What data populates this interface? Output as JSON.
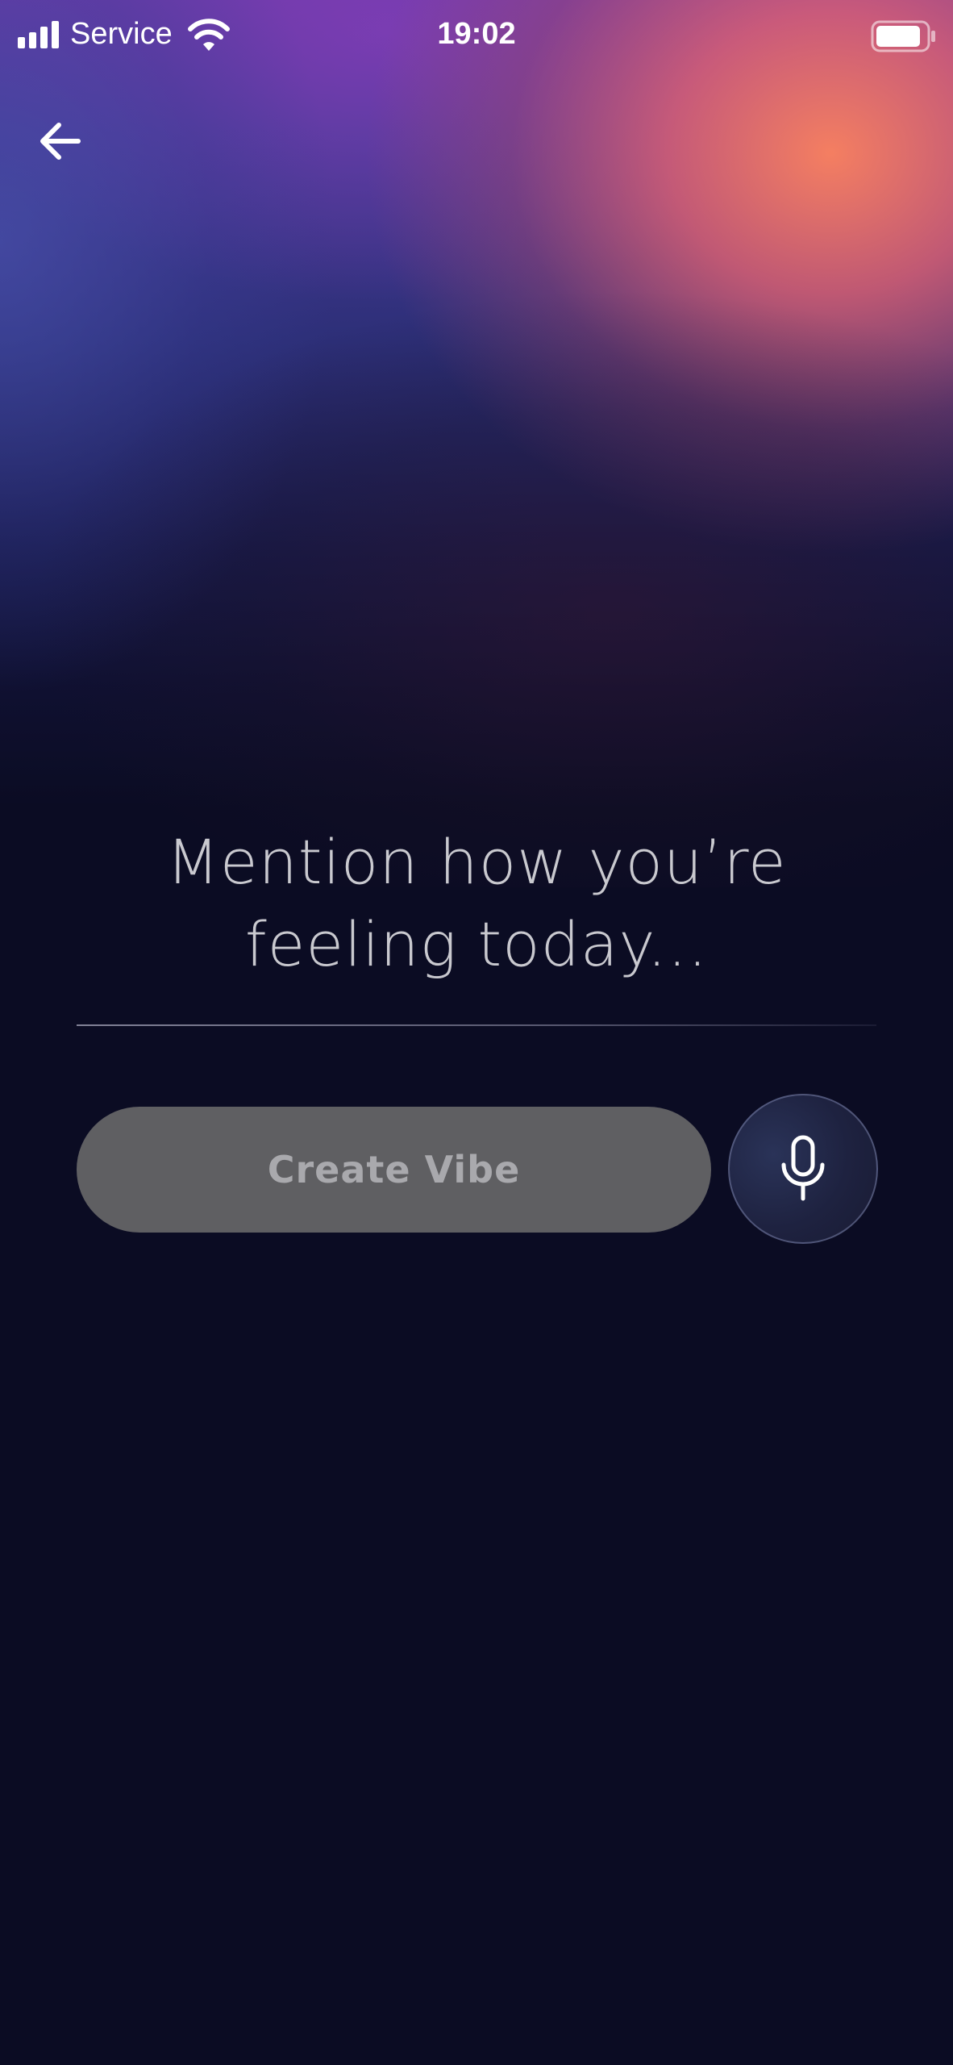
{
  "status_bar": {
    "carrier": "Service",
    "time": "19:02",
    "signal_bars_filled": 4,
    "battery_level": 0.85,
    "icons": {
      "signal": "cellular-signal-icon",
      "wifi": "wifi-icon",
      "battery": "battery-icon"
    }
  },
  "header": {
    "back_icon": "arrow-left-icon"
  },
  "main": {
    "prompt_line1": "Mention how you’re",
    "prompt_line2": "feeling today...",
    "create_button_label": "Create Vibe",
    "mic_icon": "microphone-icon"
  },
  "colors": {
    "background": "#0b0c23",
    "gradient_orange": "#f08060",
    "gradient_violet": "#6a3aa8",
    "gradient_blue": "#4a4fa8",
    "button_disabled_bg": "#5f5f62",
    "button_disabled_text": "#a9a9ad",
    "prompt_text": "#c9c9cf"
  }
}
